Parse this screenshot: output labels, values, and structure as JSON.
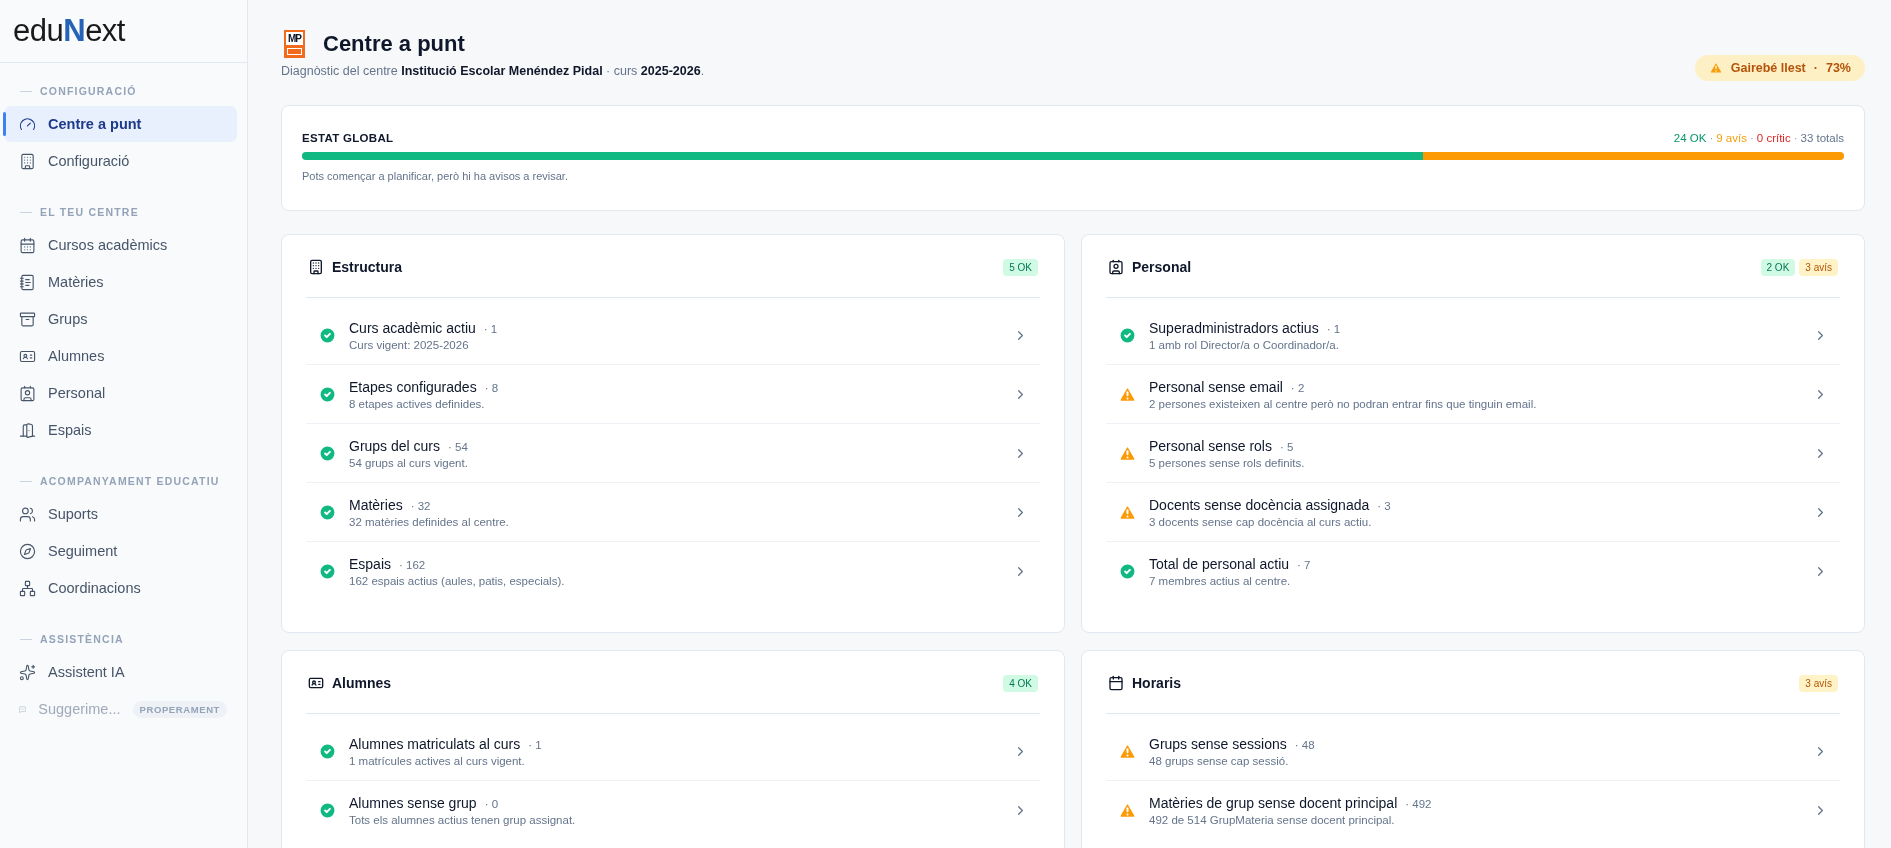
{
  "sidebar": {
    "logo": [
      {
        "kind": "plain",
        "text": "edu"
      },
      {
        "kind": "accent",
        "text": "N"
      },
      {
        "kind": "plain",
        "text": "ext"
      }
    ],
    "sections": [
      {
        "title": "CONFIGURACIÓ",
        "items": [
          {
            "label": "Centre a punt",
            "selected": true,
            "disabled": false
          },
          {
            "label": "Configuració",
            "selected": false,
            "disabled": false
          }
        ]
      },
      {
        "title": "EL TEU CENTRE",
        "items": [
          {
            "label": "Cursos acadèmics",
            "selected": false,
            "disabled": false
          },
          {
            "label": "Matèries",
            "selected": false,
            "disabled": false
          },
          {
            "label": "Grups",
            "selected": false,
            "disabled": false
          },
          {
            "label": "Alumnes",
            "selected": false,
            "disabled": false
          },
          {
            "label": "Personal",
            "selected": false,
            "disabled": false
          },
          {
            "label": "Espais",
            "selected": false,
            "disabled": false
          }
        ]
      },
      {
        "title": "ACOMPANYAMENT EDUCATIU",
        "items": [
          {
            "label": "Suports",
            "selected": false,
            "disabled": false
          },
          {
            "label": "Seguiment",
            "selected": false,
            "disabled": false
          },
          {
            "label": "Coordinacions",
            "selected": false,
            "disabled": false
          }
        ]
      },
      {
        "title": "ASSISTÈNCIA",
        "items": [
          {
            "label": "Assistent IA",
            "selected": false,
            "disabled": false
          },
          {
            "label": "Suggerime...",
            "selected": false,
            "disabled": true,
            "tag": "PROPERAMENT"
          }
        ]
      }
    ]
  },
  "header": {
    "school_logo": "MP",
    "title": "Centre a punt",
    "subtitle": "Diagnòstic del centre **Institució Escolar Menéndez Pidal** · curs **2025-2026**.",
    "status": {
      "kind": "warning",
      "label": "Gairebé llest",
      "separator": "·",
      "value": "73%"
    }
  },
  "global": {
    "title": "ESTAT GLOBAL",
    "separator": "·",
    "counts": [
      {
        "kind": "ok",
        "text": "24 OK"
      },
      {
        "kind": "warning",
        "text": "9 avís"
      },
      {
        "kind": "critical",
        "text": "0 crític"
      },
      {
        "kind": "total",
        "text": "33 totals"
      }
    ],
    "segments": [
      {
        "kind": "ok",
        "level": 0.727
      },
      {
        "kind": "warning",
        "level": 0.273
      }
    ],
    "message": "Pots començar a planificar, però hi ha avisos a revisar."
  },
  "cards": [
    {
      "title": "Estructura",
      "badges": [
        {
          "kind": "ok",
          "text": "5 OK"
        }
      ],
      "rows": [
        {
          "kind": "ok",
          "title": "Curs acadèmic actiu",
          "count": "· 1",
          "detail": "Curs vigent: 2025-2026"
        },
        {
          "kind": "ok",
          "title": "Etapes configurades",
          "count": "· 8",
          "detail": "8 etapes actives definides."
        },
        {
          "kind": "ok",
          "title": "Grups del curs",
          "count": "· 54",
          "detail": "54 grups al curs vigent."
        },
        {
          "kind": "ok",
          "title": "Matèries",
          "count": "· 32",
          "detail": "32 matèries definides al centre."
        },
        {
          "kind": "ok",
          "title": "Espais",
          "count": "· 162",
          "detail": "162 espais actius (aules, patis, especials)."
        }
      ]
    },
    {
      "title": "Personal",
      "badges": [
        {
          "kind": "ok",
          "text": "2 OK"
        },
        {
          "kind": "warning",
          "text": "3 avís"
        }
      ],
      "rows": [
        {
          "kind": "ok",
          "title": "Superadministradors actius",
          "count": "· 1",
          "detail": "1 amb rol Director/a o Coordinador/a."
        },
        {
          "kind": "warning",
          "title": "Personal sense email",
          "count": "· 2",
          "detail": "2 persones existeixen al centre però no podran entrar fins que tinguin email."
        },
        {
          "kind": "warning",
          "title": "Personal sense rols",
          "count": "· 5",
          "detail": "5 persones sense rols definits."
        },
        {
          "kind": "warning",
          "title": "Docents sense docència assignada",
          "count": "· 3",
          "detail": "3 docents sense cap docència al curs actiu."
        },
        {
          "kind": "ok",
          "title": "Total de personal actiu",
          "count": "· 7",
          "detail": "7 membres actius al centre."
        }
      ]
    },
    {
      "title": "Alumnes",
      "badges": [
        {
          "kind": "ok",
          "text": "4 OK"
        }
      ],
      "rows": [
        {
          "kind": "ok",
          "title": "Alumnes matriculats al curs",
          "count": "· 1",
          "detail": "1 matrícules actives al curs vigent."
        },
        {
          "kind": "ok",
          "title": "Alumnes sense grup",
          "count": "· 0",
          "detail": "Tots els alumnes actius tenen grup assignat."
        }
      ]
    },
    {
      "title": "Horaris",
      "badges": [
        {
          "kind": "warning",
          "text": "3 avís"
        }
      ],
      "rows": [
        {
          "kind": "warning",
          "title": "Grups sense sessions",
          "count": "· 48",
          "detail": "48 grups sense cap sessió."
        },
        {
          "kind": "warning",
          "title": "Matèries de grup sense docent principal",
          "count": "· 492",
          "detail": "492 de 514 GrupMateria sense docent principal."
        }
      ]
    }
  ]
}
